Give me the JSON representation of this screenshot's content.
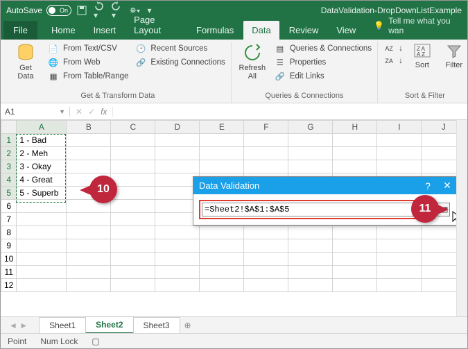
{
  "title": {
    "autosave": "AutoSave",
    "autosave_state": "On",
    "filename": "DataValidation-DropDownListExample"
  },
  "qat_icons": [
    "save-icon",
    "undo-icon",
    "redo-icon",
    "customize-icon"
  ],
  "tabs": {
    "file": "File",
    "items": [
      "Home",
      "Insert",
      "Page Layout",
      "Formulas",
      "Data",
      "Review",
      "View"
    ],
    "active": "Data",
    "tellme": "Tell me what you wan"
  },
  "ribbon": {
    "group1": {
      "bigbtn": "Get\nData",
      "items": [
        "From Text/CSV",
        "From Web",
        "From Table/Range"
      ],
      "items2": [
        "Recent Sources",
        "Existing Connections"
      ],
      "label": "Get & Transform Data"
    },
    "group2": {
      "bigbtn": "Refresh\nAll",
      "items": [
        "Queries & Connections",
        "Properties",
        "Edit Links"
      ],
      "label": "Queries & Connections"
    },
    "group3": {
      "sort": "Sort",
      "filter": "Filter",
      "label": "Sort & Filter"
    }
  },
  "namebox": "A1",
  "formula_bar": "",
  "columns": [
    "A",
    "B",
    "C",
    "D",
    "E",
    "F",
    "G",
    "H",
    "I",
    "J"
  ],
  "rows": [
    1,
    2,
    3,
    4,
    5,
    6,
    7,
    8,
    9,
    10,
    11,
    12
  ],
  "data": {
    "A1": "1 - Bad",
    "A2": "2 - Meh",
    "A3": "3 - Okay",
    "A4": "4 - Great",
    "A5": "5 - Superb"
  },
  "dialog": {
    "title": "Data Validation",
    "input": "=Sheet2!$A$1:$A$5",
    "help": "?",
    "close": "✕"
  },
  "callouts": {
    "c10": "10",
    "c11": "11"
  },
  "sheet_tabs": [
    "Sheet1",
    "Sheet2",
    "Sheet3"
  ],
  "active_sheet": "Sheet2",
  "status": {
    "mode": "Point",
    "numlock": "Num Lock"
  }
}
